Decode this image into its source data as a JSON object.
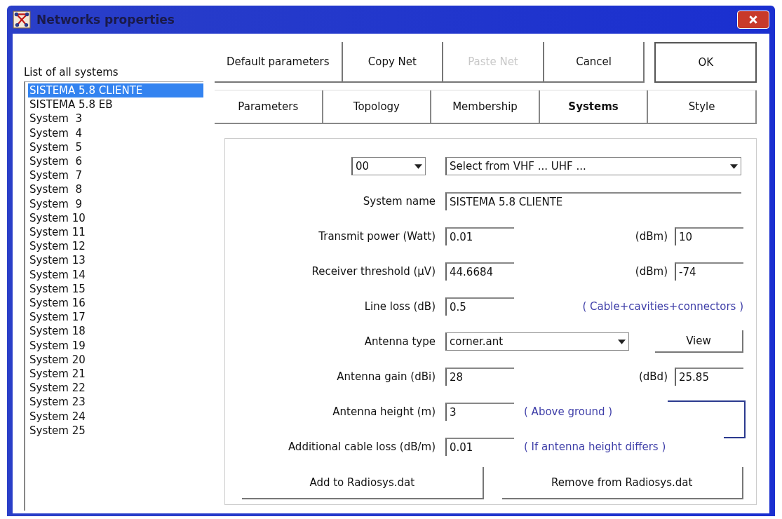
{
  "window": {
    "title": "Networks properties"
  },
  "list": {
    "label": "List of all systems",
    "items": [
      {
        "text": "SISTEMA 5.8 CLIENTE",
        "selected": true
      },
      {
        "text": "SISTEMA 5.8 EB",
        "selected": false
      },
      {
        "text": "System  3",
        "selected": false
      },
      {
        "text": "System  4",
        "selected": false
      },
      {
        "text": "System  5",
        "selected": false
      },
      {
        "text": "System  6",
        "selected": false
      },
      {
        "text": "System  7",
        "selected": false
      },
      {
        "text": "System  8",
        "selected": false
      },
      {
        "text": "System  9",
        "selected": false
      },
      {
        "text": "System 10",
        "selected": false
      },
      {
        "text": "System 11",
        "selected": false
      },
      {
        "text": "System 12",
        "selected": false
      },
      {
        "text": "System 13",
        "selected": false
      },
      {
        "text": "System 14",
        "selected": false
      },
      {
        "text": "System 15",
        "selected": false
      },
      {
        "text": "System 16",
        "selected": false
      },
      {
        "text": "System 17",
        "selected": false
      },
      {
        "text": "System 18",
        "selected": false
      },
      {
        "text": "System 19",
        "selected": false
      },
      {
        "text": "System 20",
        "selected": false
      },
      {
        "text": "System 21",
        "selected": false
      },
      {
        "text": "System 22",
        "selected": false
      },
      {
        "text": "System 23",
        "selected": false
      },
      {
        "text": "System 24",
        "selected": false
      },
      {
        "text": "System 25",
        "selected": false
      }
    ]
  },
  "buttons": [
    {
      "label": "Default parameters",
      "disabled": false
    },
    {
      "label": "Copy Net",
      "disabled": false
    },
    {
      "label": "Paste Net",
      "disabled": true
    },
    {
      "label": "Cancel",
      "disabled": false
    },
    {
      "label": "OK",
      "disabled": false
    }
  ],
  "tabs": [
    {
      "label": "Parameters",
      "selected": false
    },
    {
      "label": "Topology",
      "selected": false
    },
    {
      "label": "Membership",
      "selected": false
    },
    {
      "label": "Systems",
      "selected": true
    },
    {
      "label": "Style",
      "selected": false
    }
  ],
  "form": {
    "code_select": {
      "value": "00"
    },
    "band_select": {
      "value": "Select from VHF ... UHF ..."
    },
    "rows": [
      {
        "kind": "wide",
        "label": "System name",
        "value": "SISTEMA 5.8 CLIENTE"
      },
      {
        "kind": "pair",
        "label": "Transmit power (Watt)",
        "value": "0.01",
        "unit": "(dBm)",
        "value2": "10"
      },
      {
        "kind": "pair",
        "label": "Receiver threshold (µV)",
        "value": "44.6684",
        "unit": "(dBm)",
        "value2": "-74"
      },
      {
        "kind": "note",
        "label": "Line loss (dB)",
        "value": "0.5",
        "note": "( Cable+cavities+connectors )"
      },
      {
        "kind": "select",
        "label": "Antenna type",
        "value": "corner.ant",
        "button": "View"
      },
      {
        "kind": "pair",
        "label": "Antenna gain (dBi)",
        "value": "28",
        "unit": "(dBd)",
        "value2": "25.85"
      },
      {
        "kind": "note",
        "label": "Antenna height (m)",
        "value": "3",
        "note": "( Above ground )"
      },
      {
        "kind": "note",
        "label": "Additional cable loss (dB/m)",
        "value": "0.01",
        "note": "( If antenna height differs )"
      }
    ],
    "actions": [
      "Add to Radiosys.dat",
      "Remove from Radiosys.dat"
    ]
  }
}
